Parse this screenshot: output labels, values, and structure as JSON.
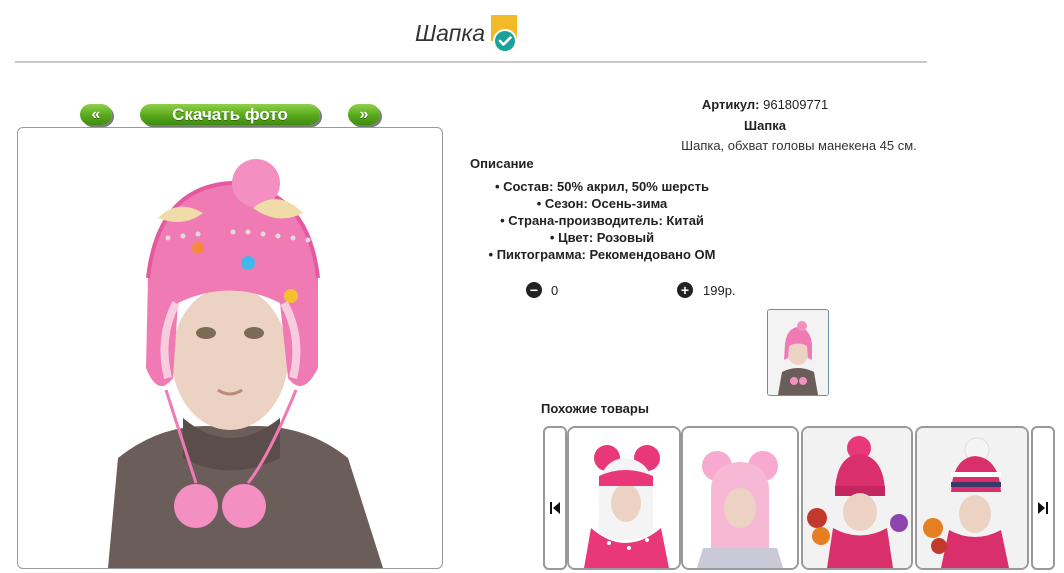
{
  "header": {
    "title": "Шапка"
  },
  "nav": {
    "prev_label": "«",
    "download_label": "Скачать фото",
    "next_label": "»"
  },
  "product": {
    "sku_label": "Артикул:",
    "sku_value": "961809771",
    "name": "Шапка",
    "short_desc": "Шапка, обхват головы манекена 45 см.",
    "desc_heading": "Описание",
    "specs": [
      "Состав: 50% акрил, 50% шерсть",
      "Сезон: Осень-зима",
      "Страна-производитель: Китай",
      "Цвет: Розовый",
      "Пиктограмма: Рекомендовано ОМ"
    ]
  },
  "order": {
    "quantity": "0",
    "price": "199р."
  },
  "similar": {
    "heading": "Похожие товары",
    "items": [
      "Product 1",
      "Product 2",
      "Product 3",
      "Product 4"
    ]
  },
  "icons": {
    "minus": "minus-circle-icon",
    "plus": "plus-circle-icon",
    "badge": "check-badge-icon"
  },
  "colors": {
    "accent_green": "#58a81c",
    "badge_yellow": "#f2b928",
    "badge_teal": "#1aa29a"
  }
}
